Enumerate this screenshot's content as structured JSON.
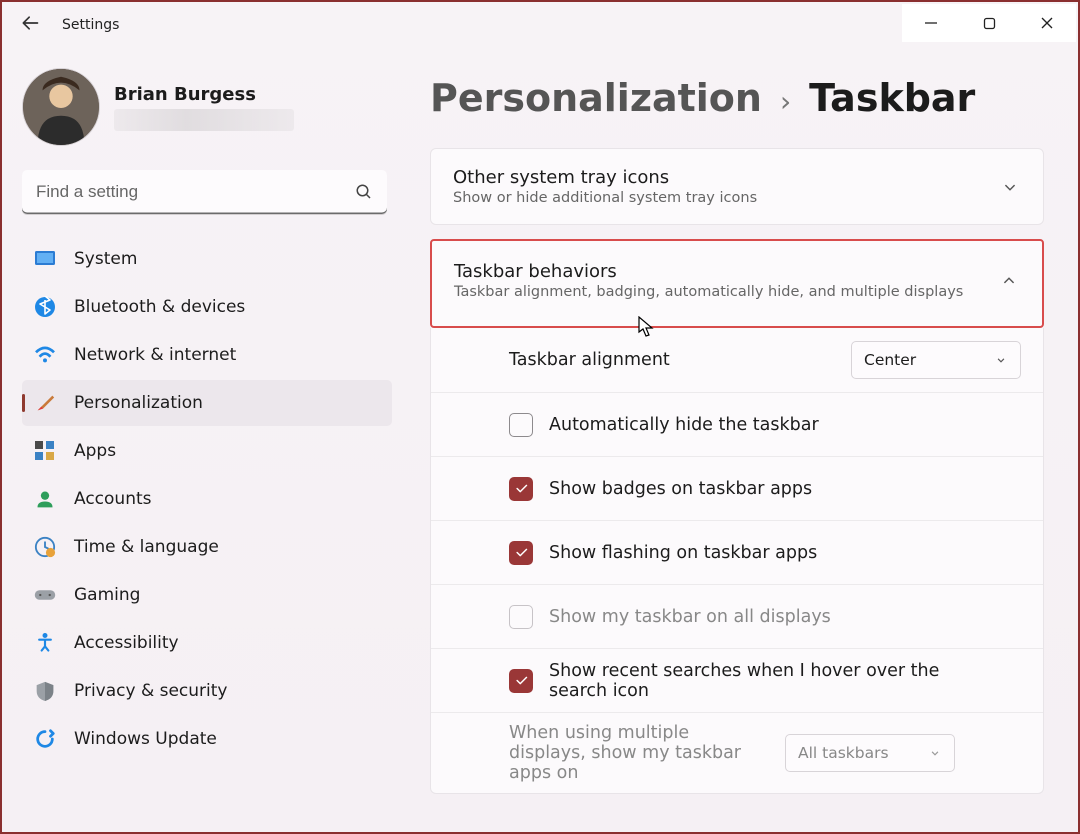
{
  "app_title": "Settings",
  "user": {
    "name": "Brian Burgess"
  },
  "search": {
    "placeholder": "Find a setting"
  },
  "nav": [
    {
      "id": "system",
      "label": "System"
    },
    {
      "id": "bluetooth",
      "label": "Bluetooth & devices"
    },
    {
      "id": "network",
      "label": "Network & internet"
    },
    {
      "id": "personalization",
      "label": "Personalization",
      "active": true
    },
    {
      "id": "apps",
      "label": "Apps"
    },
    {
      "id": "accounts",
      "label": "Accounts"
    },
    {
      "id": "time",
      "label": "Time & language"
    },
    {
      "id": "gaming",
      "label": "Gaming"
    },
    {
      "id": "accessibility",
      "label": "Accessibility"
    },
    {
      "id": "privacy",
      "label": "Privacy & security"
    },
    {
      "id": "update",
      "label": "Windows Update"
    }
  ],
  "breadcrumb": {
    "parent": "Personalization",
    "current": "Taskbar"
  },
  "panel_other": {
    "title": "Other system tray icons",
    "desc": "Show or hide additional system tray icons"
  },
  "panel_behaviors": {
    "title": "Taskbar behaviors",
    "desc": "Taskbar alignment, badging, automatically hide, and multiple displays"
  },
  "opts": {
    "alignment": {
      "label": "Taskbar alignment",
      "value": "Center"
    },
    "autohide": {
      "label": "Automatically hide the taskbar",
      "checked": false
    },
    "badges": {
      "label": "Show badges on taskbar apps",
      "checked": true
    },
    "flashing": {
      "label": "Show flashing on taskbar apps",
      "checked": true
    },
    "alldisplays": {
      "label": "Show my taskbar on all displays",
      "checked": false,
      "disabled": true
    },
    "recents": {
      "label": "Show recent searches when I hover over the search icon",
      "checked": true
    },
    "multidisplay": {
      "label": "When using multiple displays, show my taskbar apps on",
      "value": "All taskbars",
      "disabled": true
    }
  }
}
